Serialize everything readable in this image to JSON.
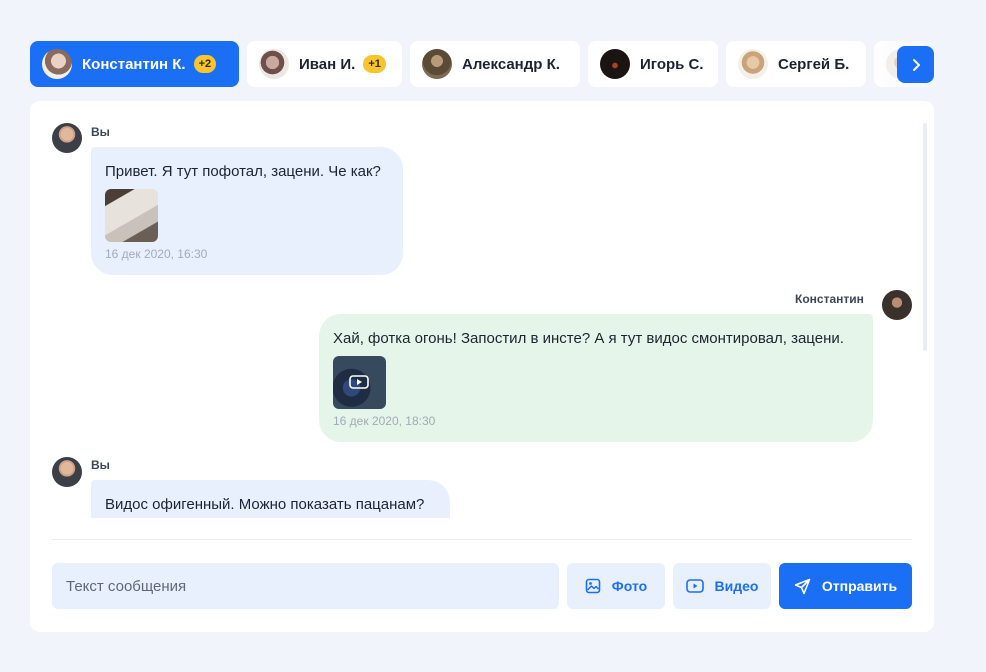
{
  "contacts": [
    {
      "name": "Константин К.",
      "badge": "+2",
      "active": true
    },
    {
      "name": "Иван И.",
      "badge": "+1",
      "active": false
    },
    {
      "name": "Александр К.",
      "active": false
    },
    {
      "name": "Игорь С.",
      "active": false
    },
    {
      "name": "Сергей Б.",
      "active": false
    }
  ],
  "messages": [
    {
      "sender": "Вы",
      "text": "Привет. Я тут пофотал, зацени. Че как?",
      "attachment": "photo",
      "time": "16 дек 2020, 16:30"
    },
    {
      "sender": "Константин",
      "text": "Хай, фотка огонь! Запостил в инсте? А я тут видос смонтировал, зацени.",
      "attachment": "video",
      "time": "16 дек 2020, 18:30"
    },
    {
      "sender": "Вы",
      "text": "Видос офигенный. Можно показать пацанам?"
    }
  ],
  "composer": {
    "placeholder": "Текст сообщения",
    "photo_label": "Фото",
    "video_label": "Видео",
    "send_label": "Отправить"
  },
  "colors": {
    "accent": "#1b6ff5",
    "my_bubble": "#e9f0fd",
    "their_bubble": "#e6f5e9",
    "badge": "#f7c52e"
  }
}
